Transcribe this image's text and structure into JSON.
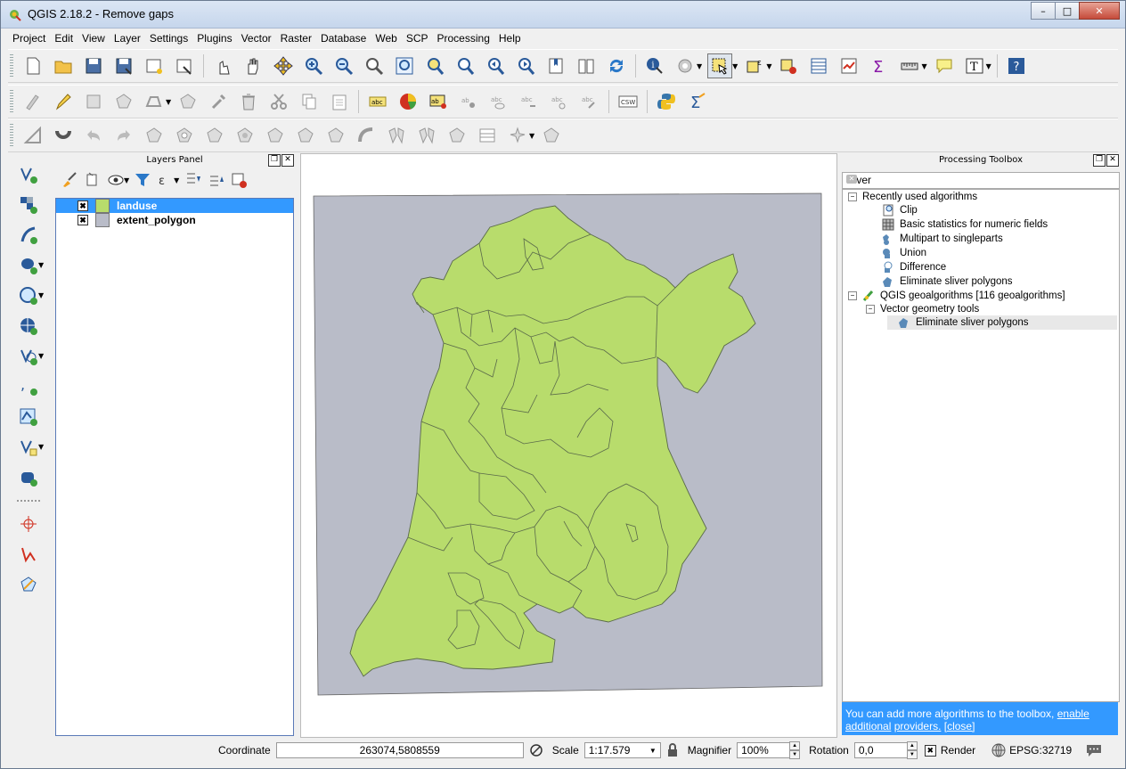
{
  "window": {
    "title": "QGIS 2.18.2 - Remove gaps",
    "controls": [
      "–",
      "□",
      "✕"
    ]
  },
  "menu": [
    "Project",
    "Edit",
    "View",
    "Layer",
    "Settings",
    "Plugins",
    "Vector",
    "Raster",
    "Database",
    "Web",
    "SCP",
    "Processing",
    "Help"
  ],
  "layers_panel": {
    "title": "Layers Panel",
    "layers": [
      {
        "name": "landuse",
        "checked": "✖",
        "selected": true,
        "color": "#b8dc6c"
      },
      {
        "name": "extent_polygon",
        "checked": "✖",
        "selected": false,
        "color": "#b9bcc8"
      }
    ]
  },
  "toolbox": {
    "title": "Processing Toolbox",
    "search_value": "sliver",
    "recent_label": "Recently used algorithms",
    "recent_items": [
      "Clip",
      "Basic statistics for numeric fields",
      "Multipart to singleparts",
      "Union",
      "Difference",
      "Eliminate sliver polygons"
    ],
    "provider": "QGIS geoalgorithms [116 geoalgorithms]",
    "group": "Vector geometry tools",
    "result": "Eliminate sliver polygons",
    "info_text": "You can add more algorithms to the toolbox,",
    "info_link1": "enable additional",
    "info_link2": "providers.",
    "info_link3": "[close]"
  },
  "map": {
    "extent_color": "#b9bcc8",
    "landuse_color": "#b8dc6c"
  },
  "status": {
    "coordinate_label": "Coordinate",
    "coordinate_value": "263074,5808559",
    "scale_label": "Scale",
    "scale_value": "1:17.579",
    "magnifier_label": "Magnifier",
    "magnifier_value": "100%",
    "rotation_label": "Rotation",
    "rotation_value": "0,0",
    "render_label": "Render",
    "crs": "EPSG:32719"
  }
}
